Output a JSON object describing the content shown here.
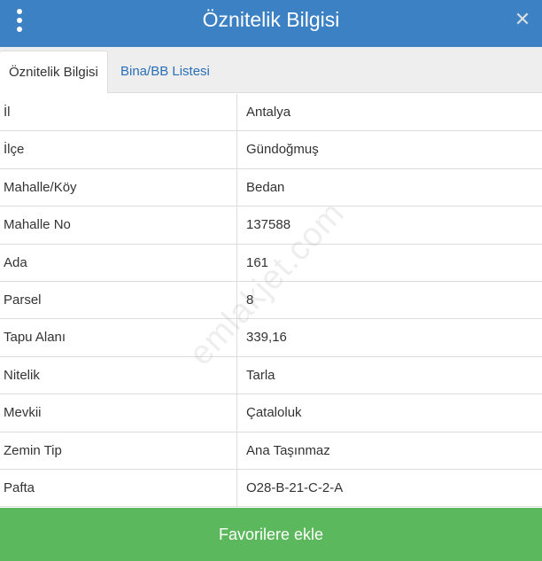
{
  "header": {
    "title": "Öznitelik Bilgisi",
    "menu_icon": "vertical-dots-icon",
    "close_icon": "close-icon",
    "color": "#3b81c4"
  },
  "tabs": [
    {
      "label": "Öznitelik Bilgisi",
      "active": true
    },
    {
      "label": "Bina/BB Listesi",
      "active": false
    }
  ],
  "rows": [
    {
      "label": "İl",
      "value": "Antalya"
    },
    {
      "label": "İlçe",
      "value": "Gündoğmuş"
    },
    {
      "label": "Mahalle/Köy",
      "value": "Bedan"
    },
    {
      "label": "Mahalle No",
      "value": "137588"
    },
    {
      "label": "Ada",
      "value": "161"
    },
    {
      "label": "Parsel",
      "value": "8"
    },
    {
      "label": "Tapu Alanı",
      "value": "339,16"
    },
    {
      "label": "Nitelik",
      "value": "Tarla"
    },
    {
      "label": "Mevkii",
      "value": "Çataloluk"
    },
    {
      "label": "Zemin Tip",
      "value": "Ana Taşınmaz"
    },
    {
      "label": "Pafta",
      "value": "O28-B-21-C-2-A"
    }
  ],
  "watermark": "emlakjet.com",
  "footer": {
    "button_label": "Favorilere ekle",
    "color": "#5cb85c"
  }
}
